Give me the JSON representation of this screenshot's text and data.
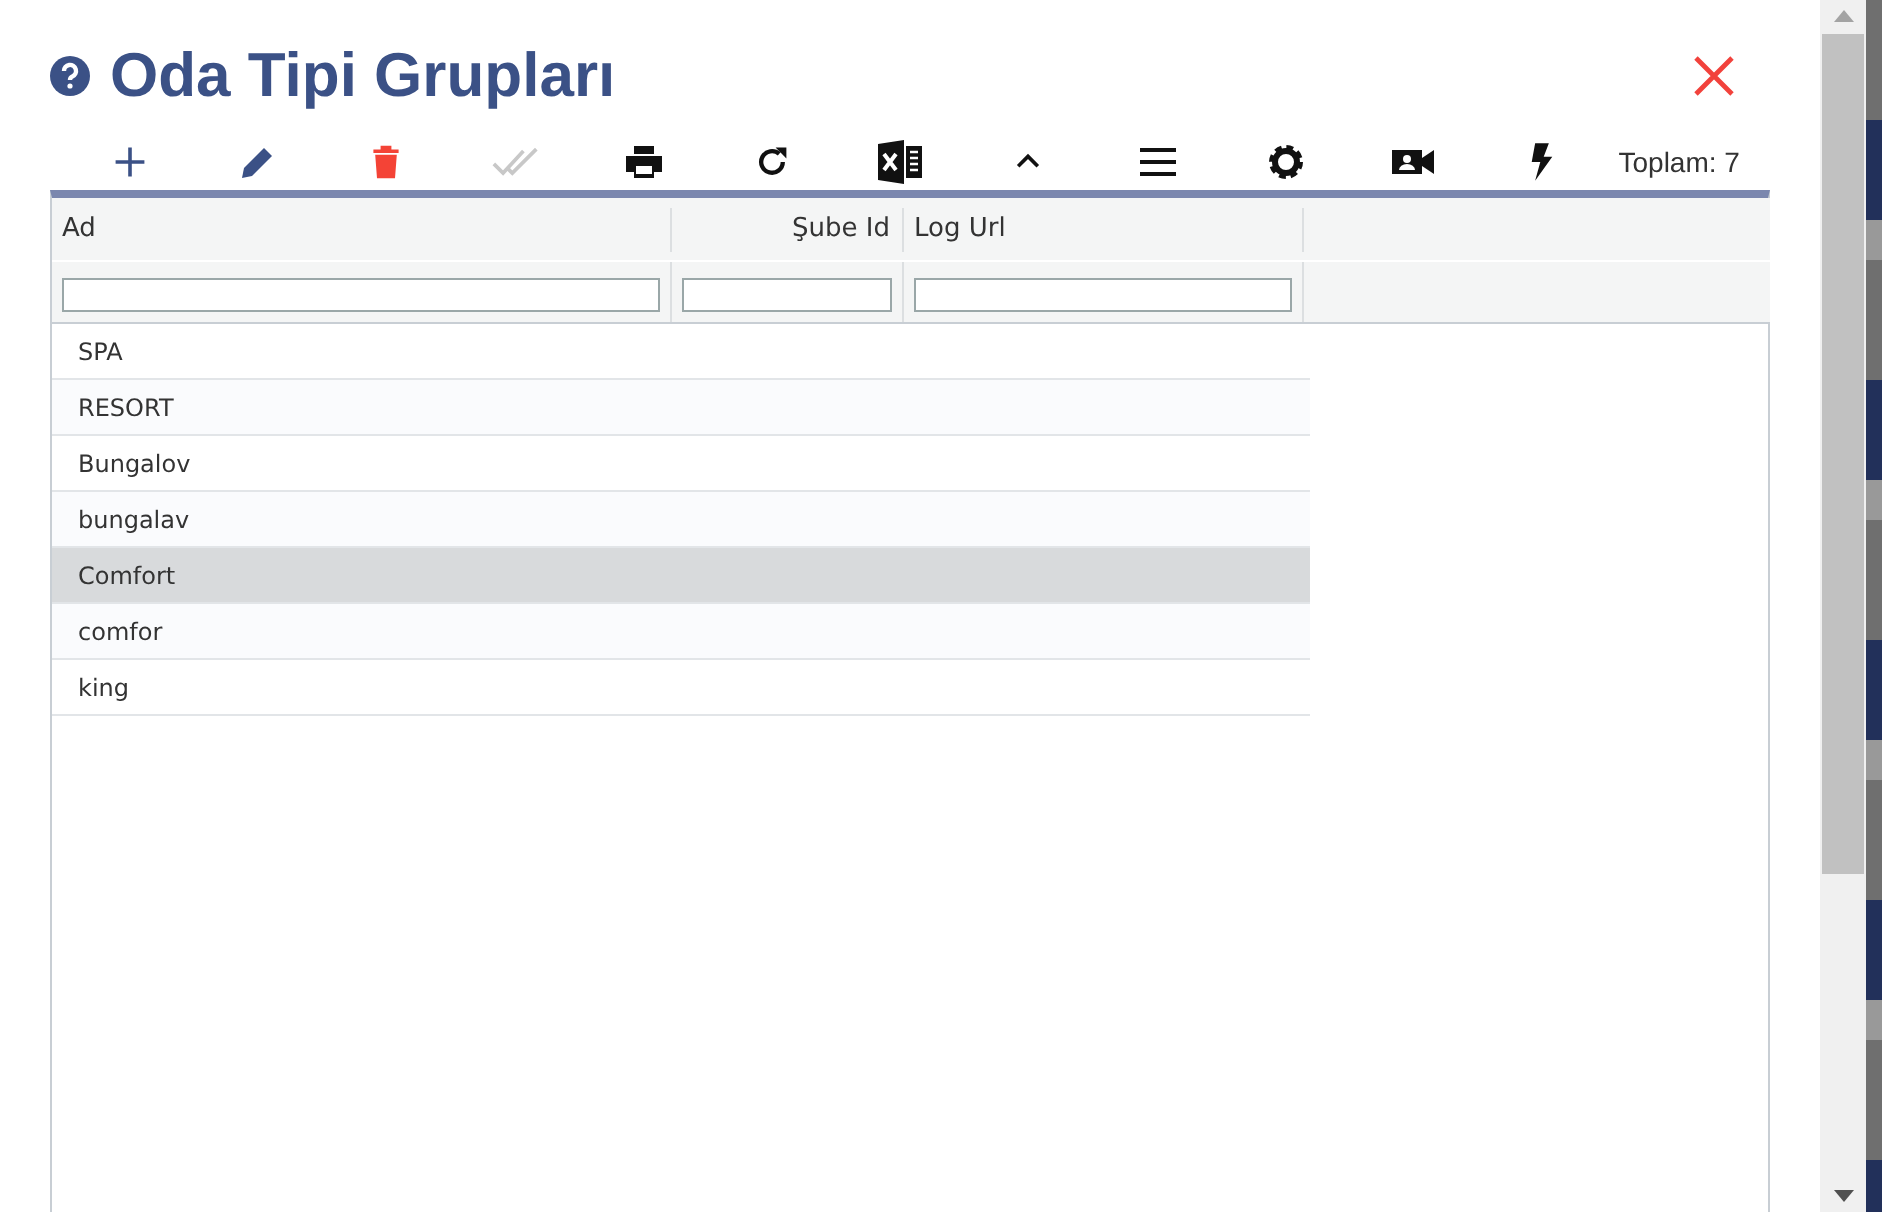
{
  "window": {
    "title": "Oda Tipi Grupları"
  },
  "toolbar": [
    {
      "kind": "add",
      "disabled": false
    },
    {
      "kind": "edit",
      "disabled": false
    },
    {
      "kind": "delete",
      "disabled": false
    },
    {
      "kind": "approve",
      "disabled": true
    },
    {
      "kind": "print",
      "disabled": false
    },
    {
      "kind": "refresh",
      "disabled": false
    },
    {
      "kind": "excel",
      "disabled": false
    },
    {
      "kind": "collapse",
      "disabled": false
    },
    {
      "kind": "menu",
      "disabled": false
    },
    {
      "kind": "settings",
      "disabled": false
    },
    {
      "kind": "video",
      "disabled": false
    },
    {
      "kind": "flash",
      "disabled": false
    }
  ],
  "total": "Toplam: 7",
  "table": {
    "columns": [
      {
        "label": "Ad"
      },
      {
        "label": "Şube Id"
      },
      {
        "label": "Log Url"
      }
    ],
    "rows": [
      {
        "cells": [
          "SPA"
        ],
        "selected": false
      },
      {
        "cells": [
          "RESORT"
        ],
        "selected": false
      },
      {
        "cells": [
          "Bungalov"
        ],
        "selected": false
      },
      {
        "cells": [
          "bungalav"
        ],
        "selected": false
      },
      {
        "cells": [
          "Comfort"
        ],
        "selected": true
      },
      {
        "cells": [
          "comfor"
        ],
        "selected": false
      },
      {
        "cells": [
          "king"
        ],
        "selected": false
      }
    ]
  }
}
